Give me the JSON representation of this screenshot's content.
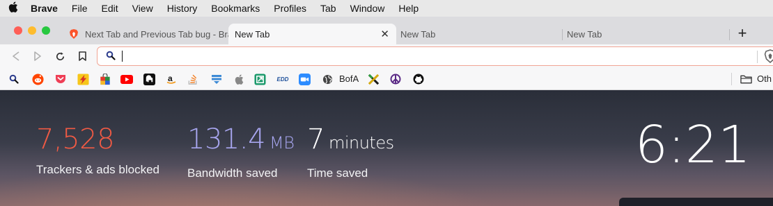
{
  "menubar": {
    "apple_icon": "apple-logo-icon",
    "items": [
      "Brave",
      "File",
      "Edit",
      "View",
      "History",
      "Bookmarks",
      "Profiles",
      "Tab",
      "Window",
      "Help"
    ]
  },
  "tabs": [
    {
      "title": "Next Tab and Previous Tab bug - Brave Community",
      "icon": "brave-lion-icon",
      "active": false
    },
    {
      "title": "New Tab",
      "icon": "",
      "active": true
    },
    {
      "title": "New Tab",
      "icon": "",
      "active": false
    },
    {
      "title": "New Tab",
      "icon": "",
      "active": false
    }
  ],
  "toolbar": {
    "back_icon": "back-arrow-icon",
    "forward_icon": "forward-arrow-icon",
    "reload_icon": "reload-icon",
    "bookmark_icon": "bookmark-icon",
    "omnibox": {
      "value": "",
      "placeholder": ""
    },
    "shield_icon": "brave-shield-icon"
  },
  "bookmarks": {
    "items": [
      {
        "icon": "search-icon",
        "label": ""
      },
      {
        "icon": "reddit-icon",
        "label": ""
      },
      {
        "icon": "pocket-icon",
        "label": ""
      },
      {
        "icon": "lightning-icon",
        "label": ""
      },
      {
        "icon": "shopping-bag-icon",
        "label": ""
      },
      {
        "icon": "youtube-icon",
        "label": ""
      },
      {
        "icon": "elephant-icon",
        "label": ""
      },
      {
        "icon": "amazon-icon",
        "label": ""
      },
      {
        "icon": "stackoverflow-icon",
        "label": ""
      },
      {
        "icon": "stack-icon",
        "label": ""
      },
      {
        "icon": "apple-icon",
        "label": ""
      },
      {
        "icon": "arrow-box-icon",
        "label": ""
      },
      {
        "icon": "edd-icon",
        "label": "EDD"
      },
      {
        "icon": "zoom-icon",
        "label": ""
      },
      {
        "icon": "globe-icon",
        "label": "BofA"
      },
      {
        "icon": "x-logo-icon",
        "label": ""
      },
      {
        "icon": "peace-icon",
        "label": ""
      },
      {
        "icon": "github-icon",
        "label": ""
      }
    ],
    "other_label": "Oth",
    "other_icon": "folder-icon"
  },
  "ntp": {
    "trackers": {
      "value": "7,528",
      "label": "Trackers & ads blocked",
      "color": "#f05a44"
    },
    "bandwidth": {
      "value": "131.4",
      "unit": "MB",
      "label": "Bandwidth saved",
      "color": "#a8a6f0"
    },
    "time": {
      "value": "7",
      "unit": "minutes",
      "label": "Time saved",
      "color": "#ffffff"
    },
    "clock": "6:21"
  }
}
